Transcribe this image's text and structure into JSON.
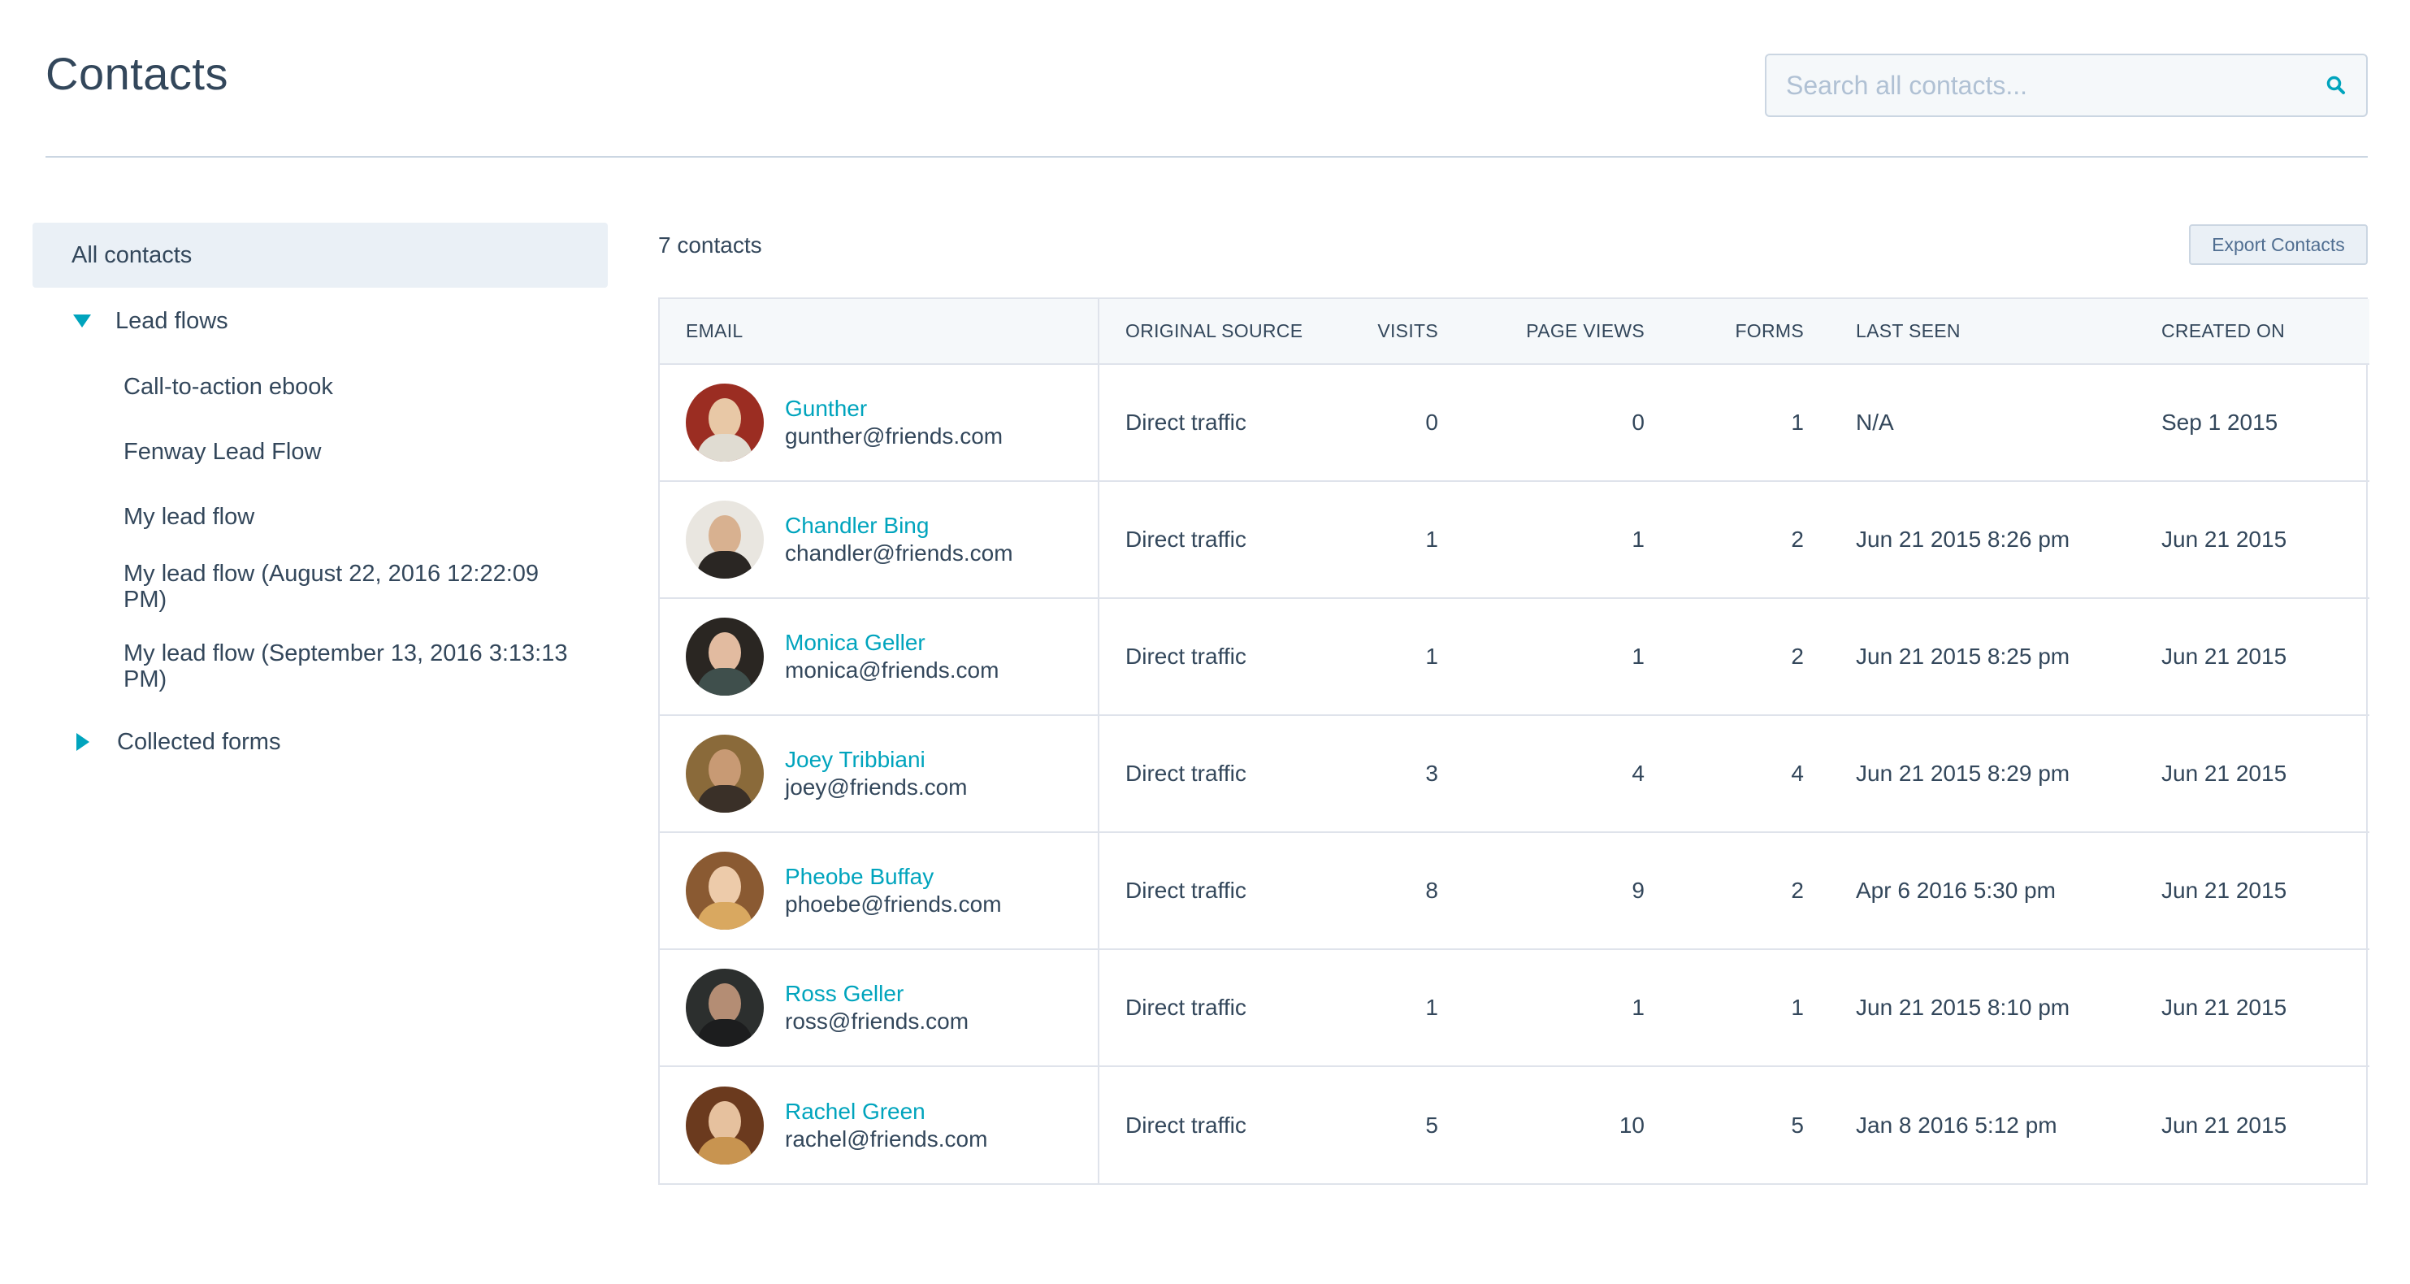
{
  "header": {
    "title": "Contacts",
    "search_placeholder": "Search all contacts..."
  },
  "sidebar": {
    "all_contacts": "All contacts",
    "lead_flows": {
      "label": "Lead flows",
      "expanded": true,
      "items": [
        "Call-to-action ebook",
        "Fenway Lead Flow",
        "My lead flow",
        "My lead flow (August 22, 2016 12:22:09 PM)",
        "My lead flow (September 13, 2016 3:13:13 PM)"
      ]
    },
    "collected_forms": {
      "label": "Collected forms",
      "expanded": false
    }
  },
  "main": {
    "count_label": "7 contacts",
    "export_label": "Export Contacts",
    "columns": [
      "EMAIL",
      "ORIGINAL SOURCE",
      "VISITS",
      "PAGE VIEWS",
      "FORMS",
      "LAST SEEN",
      "CREATED ON"
    ],
    "rows": [
      {
        "name": "Gunther",
        "email": "gunther@friends.com",
        "source": "Direct traffic",
        "visits": "0",
        "page_views": "0",
        "forms": "1",
        "last_seen": "N/A",
        "created_on": "Sep 1 2015",
        "avatar_bg": "#9b2d22",
        "avatar_face": "#e8c8a6",
        "avatar_body": "#e0dcd2"
      },
      {
        "name": "Chandler Bing",
        "email": "chandler@friends.com",
        "source": "Direct traffic",
        "visits": "1",
        "page_views": "1",
        "forms": "2",
        "last_seen": "Jun 21 2015 8:26 pm",
        "created_on": "Jun 21 2015",
        "avatar_bg": "#e9e6e0",
        "avatar_face": "#d8b190",
        "avatar_body": "#2a2623"
      },
      {
        "name": "Monica Geller",
        "email": "monica@friends.com",
        "source": "Direct traffic",
        "visits": "1",
        "page_views": "1",
        "forms": "2",
        "last_seen": "Jun 21 2015 8:25 pm",
        "created_on": "Jun 21 2015",
        "avatar_bg": "#2a2622",
        "avatar_face": "#e2bba0",
        "avatar_body": "#3f4f4c"
      },
      {
        "name": "Joey Tribbiani",
        "email": "joey@friends.com",
        "source": "Direct traffic",
        "visits": "3",
        "page_views": "4",
        "forms": "4",
        "last_seen": "Jun 21 2015 8:29 pm",
        "created_on": "Jun 21 2015",
        "avatar_bg": "#8a6a3a",
        "avatar_face": "#c89a74",
        "avatar_body": "#3a3028"
      },
      {
        "name": "Pheobe Buffay",
        "email": "phoebe@friends.com",
        "source": "Direct traffic",
        "visits": "8",
        "page_views": "9",
        "forms": "2",
        "last_seen": "Apr 6 2016 5:30 pm",
        "created_on": "Jun 21 2015",
        "avatar_bg": "#8a5a32",
        "avatar_face": "#edcbaa",
        "avatar_body": "#d9a860"
      },
      {
        "name": "Ross Geller",
        "email": "ross@friends.com",
        "source": "Direct traffic",
        "visits": "1",
        "page_views": "1",
        "forms": "1",
        "last_seen": "Jun 21 2015 8:10 pm",
        "created_on": "Jun 21 2015",
        "avatar_bg": "#2c2f2e",
        "avatar_face": "#b48d74",
        "avatar_body": "#1c1d1e"
      },
      {
        "name": "Rachel Green",
        "email": "rachel@friends.com",
        "source": "Direct traffic",
        "visits": "5",
        "page_views": "10",
        "forms": "5",
        "last_seen": "Jan 8 2016 5:12 pm",
        "created_on": "Jun 21 2015",
        "avatar_bg": "#6b3a1e",
        "avatar_face": "#e6c19e",
        "avatar_body": "#c89450"
      }
    ]
  },
  "colors": {
    "accent": "#00a4bd",
    "text": "#33475b",
    "border": "#dfe3eb"
  }
}
